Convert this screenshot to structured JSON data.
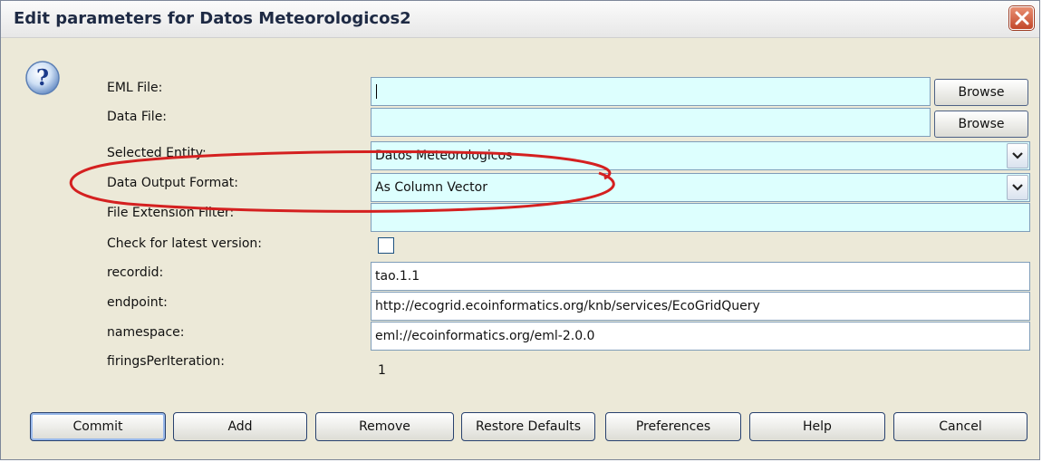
{
  "window": {
    "title": "Edit parameters for Datos Meteorologicos2"
  },
  "icons": {
    "help": "question-mark-icon",
    "close": "close-x-icon",
    "dropdown": "chevron-down-icon"
  },
  "colors": {
    "field_cyan": "#ddfffe",
    "annotation_oval": "#d42020",
    "dialog_bg": "#ece9d8"
  },
  "params": {
    "eml_file": {
      "label": "EML File:",
      "value": "",
      "browse": "Browse"
    },
    "data_file": {
      "label": "Data File:",
      "value": "",
      "browse": "Browse"
    },
    "selected_entity": {
      "label": "Selected Entity:",
      "value": "Datos Meteorologicos"
    },
    "data_output_format": {
      "label": "Data Output Format:",
      "value": "As Column Vector"
    },
    "file_extension_filter": {
      "label": "File Extension Filter:",
      "value": ""
    },
    "check_latest": {
      "label": "Check for latest version:",
      "checked": false
    },
    "recordid": {
      "label": "recordid:",
      "value": "tao.1.1"
    },
    "endpoint": {
      "label": "endpoint:",
      "value": "http://ecogrid.ecoinformatics.org/knb/services/EcoGridQuery"
    },
    "namespace": {
      "label": "namespace:",
      "value": "eml://ecoinformatics.org/eml-2.0.0"
    },
    "firings": {
      "label": "firingsPerIteration:",
      "value": "1"
    }
  },
  "buttons": {
    "commit": "Commit",
    "add": "Add",
    "remove": "Remove",
    "restore": "Restore Defaults",
    "preferences": "Preferences",
    "help": "Help",
    "cancel": "Cancel"
  }
}
